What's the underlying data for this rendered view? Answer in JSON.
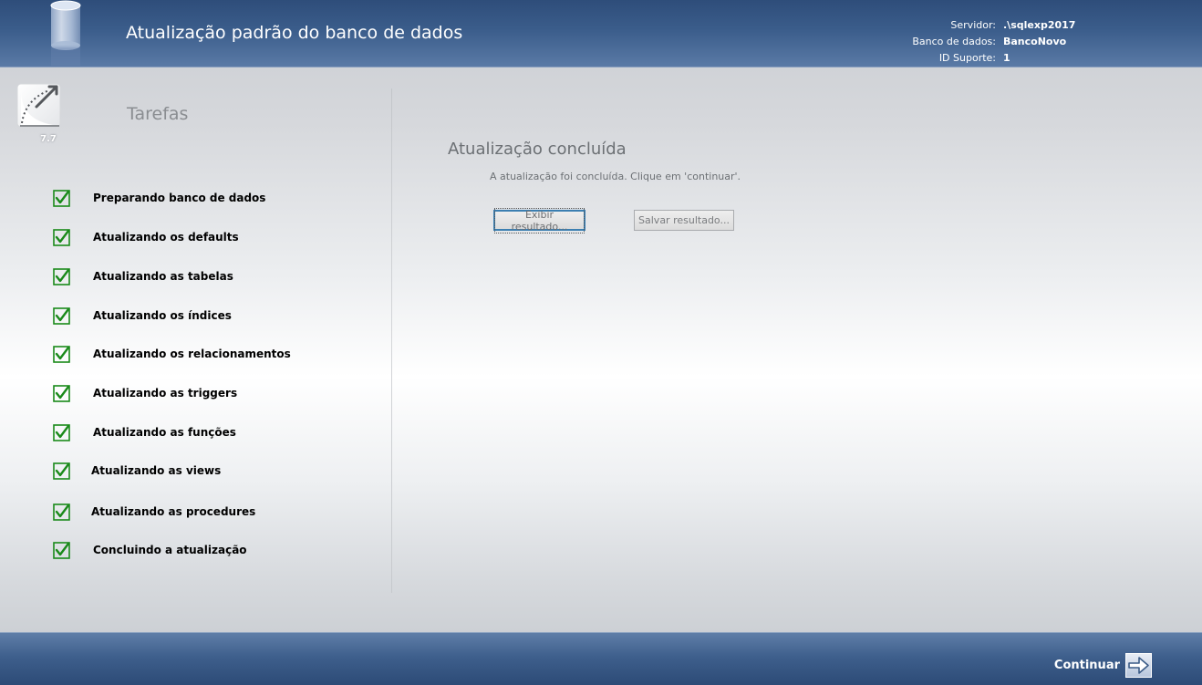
{
  "header": {
    "title": "Atualização padrão do banco de dados",
    "server_label": "Servidor:",
    "server_value": ".\\sqlexp2017",
    "database_label": "Banco de dados:",
    "database_value": "BancoNovo",
    "support_label": "ID Suporte:",
    "support_value": "1",
    "icon": "database-cylinder-icon"
  },
  "sidebar": {
    "logo_icon": "app-logo-icon",
    "version": "7.7",
    "title": "Tarefas",
    "tasks": [
      {
        "label": "Preparando banco de dados",
        "done": true
      },
      {
        "label": "Atualizando os defaults",
        "done": true
      },
      {
        "label": "Atualizando as tabelas",
        "done": true
      },
      {
        "label": "Atualizando os índices",
        "done": true
      },
      {
        "label": "Atualizando os relacionamentos",
        "done": true
      },
      {
        "label": "Atualizando as triggers",
        "done": true
      },
      {
        "label": "Atualizando as funções",
        "done": true
      },
      {
        "label": "Atualizando as views",
        "done": true
      },
      {
        "label": "Atualizando as procedures",
        "done": true
      },
      {
        "label": "Concluindo a atualização",
        "done": true
      }
    ]
  },
  "main": {
    "title": "Atualização concluída",
    "message": "A atualização foi concluída. Clique em 'continuar'.",
    "show_result_button": "Exibir resultado...",
    "save_result_button": "Salvar resultado..."
  },
  "footer": {
    "continue_label": "Continuar",
    "continue_icon": "arrow-right-icon"
  },
  "colors": {
    "header_blue": "#3b5d8b",
    "check_green": "#1a8a1a",
    "focus_border": "#3c7fb1"
  }
}
